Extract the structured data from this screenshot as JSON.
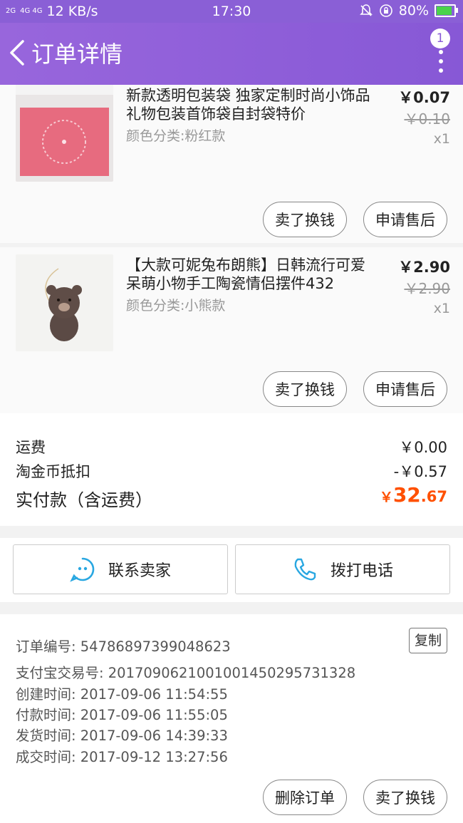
{
  "status_bar": {
    "signal_a": "2G",
    "signal_b": "4G 4G",
    "speed": "12 KB/s",
    "time": "17:30",
    "battery": "80%"
  },
  "nav": {
    "title": "订单详情",
    "badge_count": "1"
  },
  "items": [
    {
      "title": "新款透明包装袋 独家定制时尚小饰品礼物包装首饰袋自封袋特价",
      "sku": "颜色分类:粉红款",
      "price": "￥0.07",
      "original_price": "￥0.10",
      "qty": "x1",
      "sell_label": "卖了换钱",
      "aftersale_label": "申请售后"
    },
    {
      "title": "【大款可妮兔布朗熊】日韩流行可爱呆萌小物手工陶瓷情侣摆件432",
      "sku": "颜色分类:小熊款",
      "price": "￥2.90",
      "original_price": "￥2.90",
      "qty": "x1",
      "sell_label": "卖了换钱",
      "aftersale_label": "申请售后"
    }
  ],
  "totals": {
    "shipping_label": "运费",
    "shipping_value": "￥0.00",
    "coin_label": "淘金币抵扣",
    "coin_value": "-￥0.57",
    "paid_label": "实付款（含运费）",
    "paid_symbol": "￥",
    "paid_int": "32",
    "paid_dec": ".67"
  },
  "contact": {
    "seller_label": "联系卖家",
    "call_label": "拨打电话"
  },
  "order_info": {
    "order_no": "订单编号: 54786897399048623",
    "copy_label": "复制",
    "alipay_no": "支付宝交易号: 2017090621001001450295731328",
    "created": "创建时间: 2017-09-06 11:54:55",
    "paid": "付款时间: 2017-09-06 11:55:05",
    "shipped": "发货时间: 2017-09-06 14:39:33",
    "completed": "成交时间: 2017-09-12 13:27:56",
    "delete_label": "删除订单",
    "sell_label": "卖了换钱"
  },
  "colors": {
    "accent": "#8a5fd6",
    "price_orange": "#ff5000",
    "contact_icon": "#29a7e1"
  }
}
